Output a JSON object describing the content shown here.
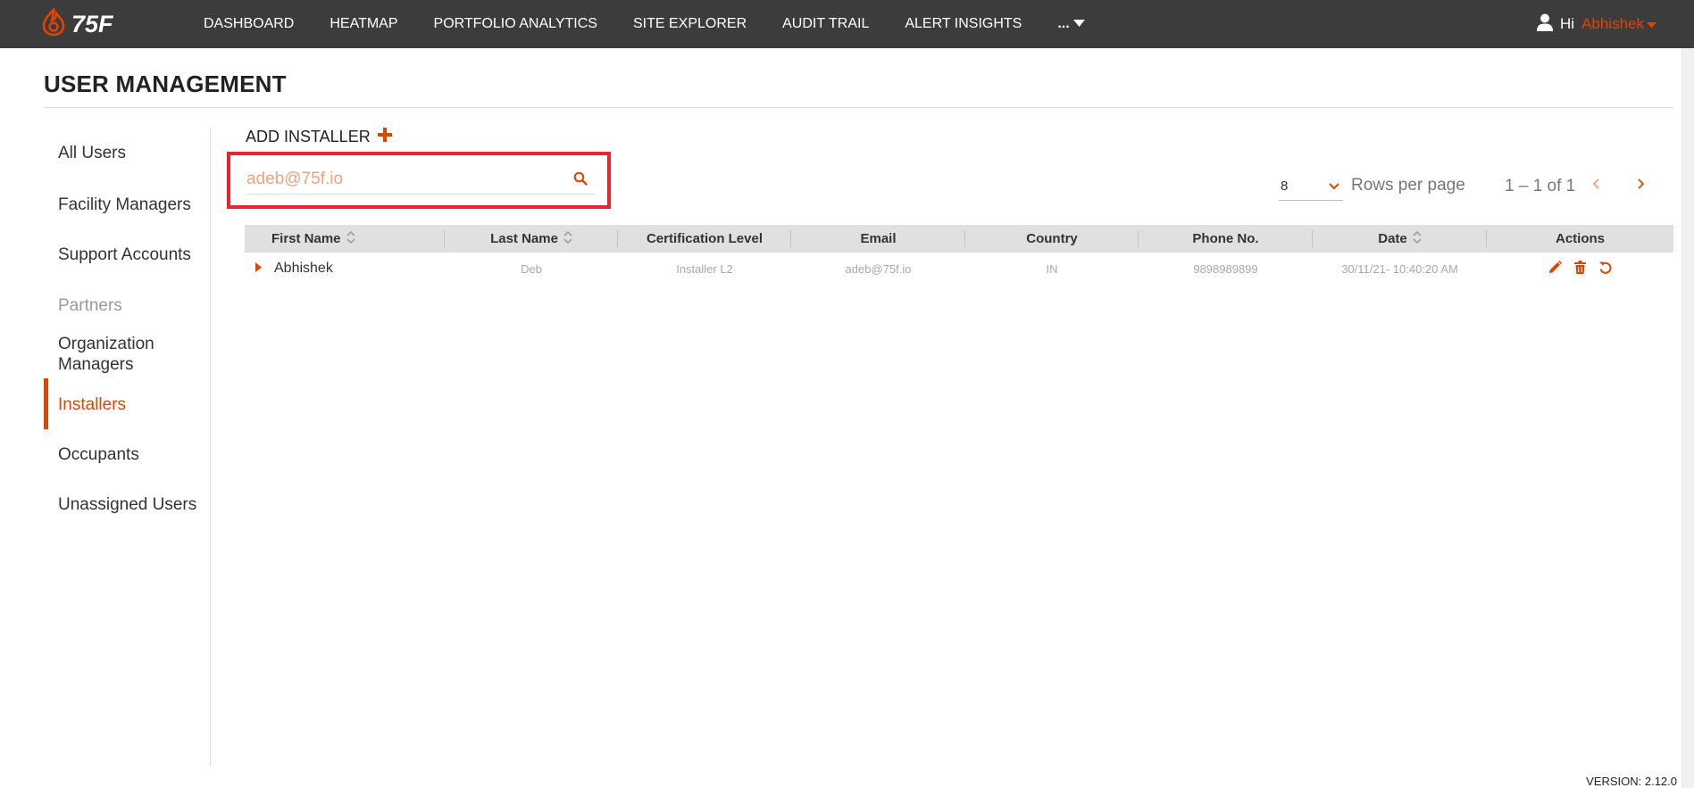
{
  "colors": {
    "accent": "#e24301",
    "topbar": "#3c3c3c",
    "highlight_border": "#e8242e"
  },
  "header": {
    "logo_text": "75F",
    "nav": [
      "DASHBOARD",
      "HEATMAP",
      "PORTFOLIO ANALYTICS",
      "SITE EXPLORER",
      "AUDIT TRAIL",
      "ALERT INSIGHTS"
    ],
    "more_label": "...",
    "greeting": "Hi",
    "user_name": "Abhishek"
  },
  "page": {
    "title": "USER MANAGEMENT",
    "version": "VERSION: 2.12.0"
  },
  "sidebar": {
    "items": [
      {
        "label": "All Users"
      },
      {
        "label": "Facility Managers"
      },
      {
        "label": "Support Accounts"
      },
      {
        "label": "Partners"
      },
      {
        "label": "Organization Managers"
      },
      {
        "label": "Installers"
      },
      {
        "label": "Occupants"
      },
      {
        "label": "Unassigned Users"
      }
    ],
    "active": "Installers"
  },
  "toolbar": {
    "add_label": "ADD INSTALLER"
  },
  "search": {
    "value": "adeb@75f.io"
  },
  "pagination": {
    "rows_per_page": "8",
    "rows_label": "Rows per page",
    "range": "1 – 1 of 1"
  },
  "table": {
    "columns": [
      "First Name",
      "Last Name",
      "Certification Level",
      "Email",
      "Country",
      "Phone No.",
      "Date",
      "Actions"
    ],
    "rows": [
      {
        "first_name": "Abhishek",
        "last_name": "Deb",
        "certification": "Installer L2",
        "email": "adeb@75f.io",
        "country": "IN",
        "phone": "9898989899",
        "date": "30/11/21- 10:40:20 AM"
      }
    ]
  }
}
